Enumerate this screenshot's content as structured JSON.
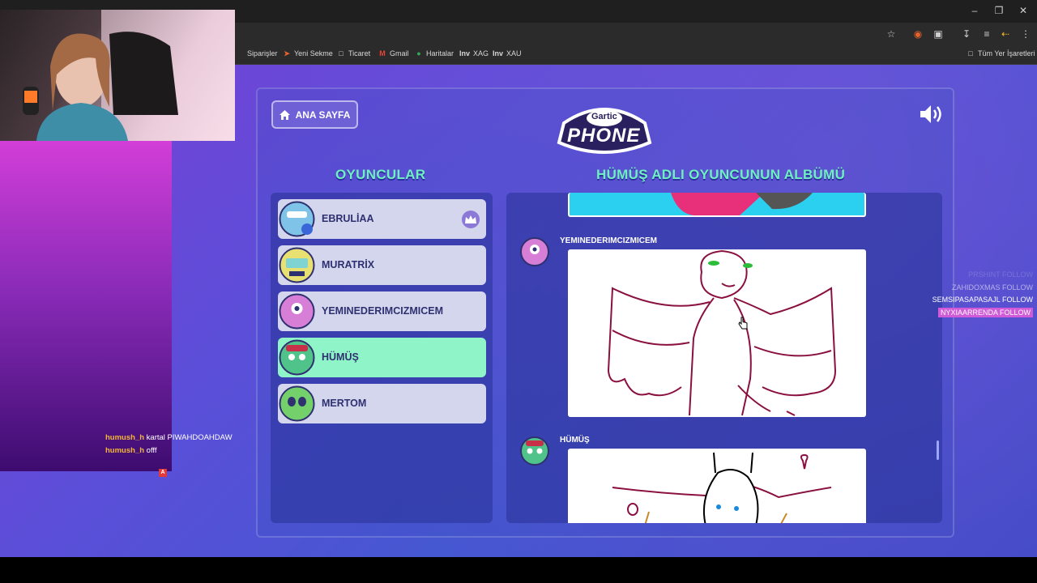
{
  "browser": {
    "bookmarks": [
      {
        "label": "Siparişler",
        "icon": "orders-icon"
      },
      {
        "label": "Yeni Sekme",
        "icon": "new-tab-icon"
      },
      {
        "label": "Ticaret",
        "icon": "folder-icon"
      },
      {
        "label": "Gmail",
        "icon": "gmail-icon"
      },
      {
        "label": "Haritalar",
        "icon": "maps-icon"
      },
      {
        "label": "XAG",
        "icon": "investing-icon",
        "prefix": "Inv"
      },
      {
        "label": "XAU",
        "icon": "investing-icon",
        "prefix": "Inv"
      }
    ],
    "all_bookmarks": "Tüm Yer İşaretleri"
  },
  "game": {
    "home_button": "ANA SAYFA",
    "logo_top": "Gartic",
    "logo_bottom": "PHONE",
    "players_heading": "OYUNCULAR",
    "album_heading": "HÜMÜŞ ADLI OYUNCUNUN ALBÜMÜ",
    "players": [
      {
        "name": "EBRULİAA",
        "host": true,
        "avatar_color": "#7fc4e8"
      },
      {
        "name": "MURATRİX",
        "host": false,
        "avatar_color": "#e8e070"
      },
      {
        "name": "YEMINEDERIMCIZMICEM",
        "host": false,
        "avatar_color": "#d77fd6"
      },
      {
        "name": "HÜMÜŞ",
        "host": false,
        "active": true,
        "avatar_color": "#4fc38a"
      },
      {
        "name": "MERTOM",
        "host": false,
        "avatar_color": "#74d06a"
      }
    ],
    "album": {
      "entries": [
        {
          "author": "YEMINEDERIMCIZMICEM"
        },
        {
          "author": "HÜMÜŞ"
        }
      ]
    }
  },
  "stream": {
    "chat": [
      {
        "user": "humush_h",
        "message": "kartal PIWAHDOAHDAW"
      },
      {
        "user": "humush_h",
        "message": "offf"
      }
    ],
    "follows": [
      {
        "name": "PRSHINT",
        "label": "FOLLOW",
        "style": "faded"
      },
      {
        "name": "ZAHIDOXMAS",
        "label": "FOLLOW",
        "style": "dim"
      },
      {
        "name": "SEMSIPASAPASAJL",
        "label": "FOLLOW",
        "style": "normal"
      },
      {
        "name": "NYXIAARRENDA",
        "label": "FOLLOW",
        "style": "highlight"
      }
    ],
    "colors": {
      "chat_user": "#f3b63a",
      "follow_highlight": "#d05ad8",
      "accent": "#6ff0c0"
    }
  }
}
